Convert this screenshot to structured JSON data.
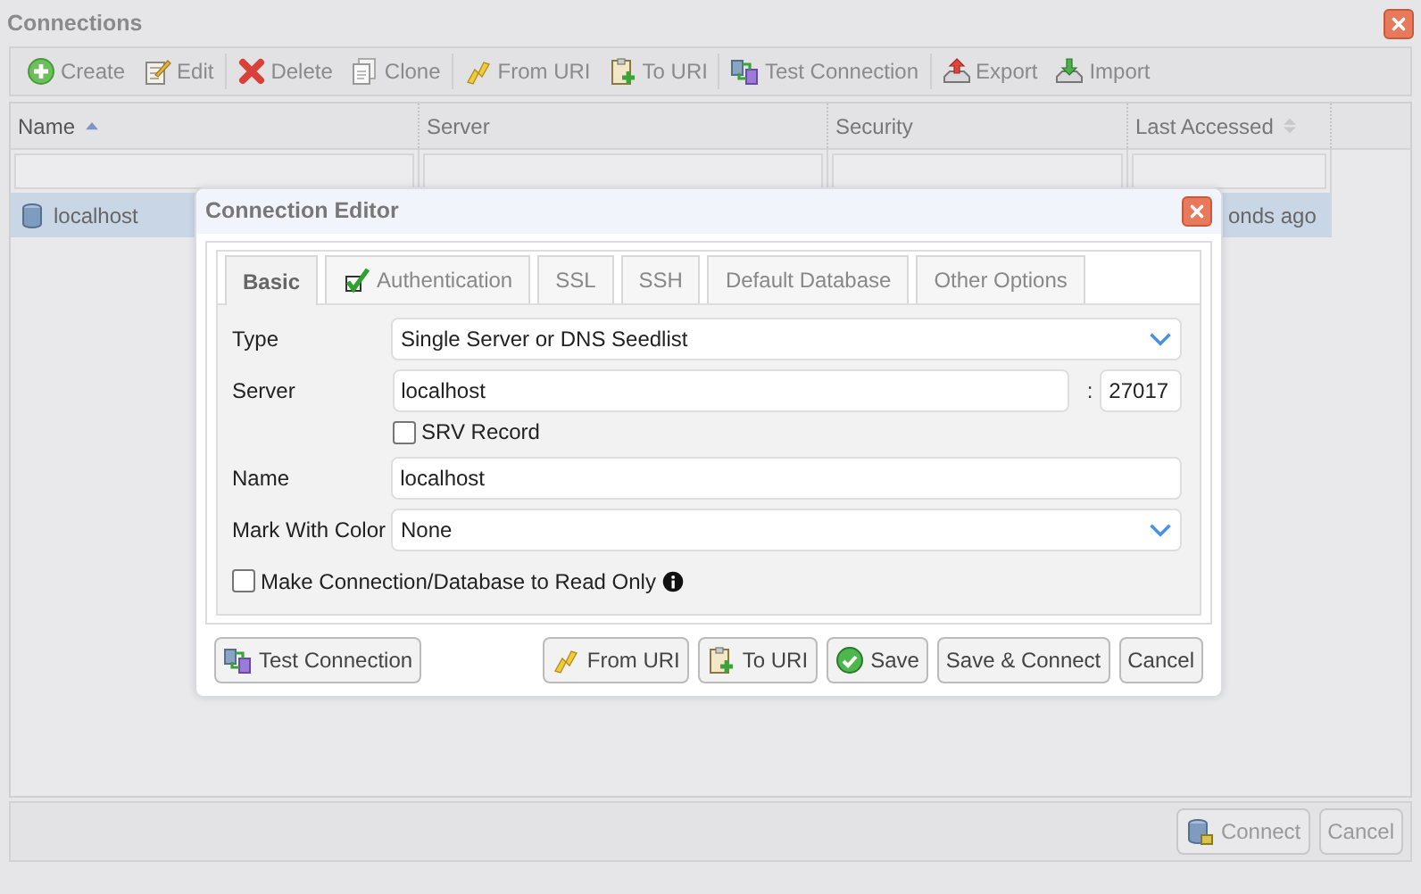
{
  "window": {
    "title": "Connections"
  },
  "toolbar": [
    {
      "label": "Create"
    },
    {
      "label": "Edit"
    },
    {
      "label": "Delete"
    },
    {
      "label": "Clone"
    },
    {
      "label": "From URI"
    },
    {
      "label": "To URI"
    },
    {
      "label": "Test Connection"
    },
    {
      "label": "Export"
    },
    {
      "label": "Import"
    }
  ],
  "grid": {
    "columns": [
      {
        "label": "Name",
        "kind": "sortable",
        "sorted": true
      },
      {
        "label": "Server",
        "kind": "plain",
        "sorted": false
      },
      {
        "label": "Security",
        "kind": "plain",
        "sorted": false
      },
      {
        "label": "Last Accessed",
        "kind": "sortable",
        "sorted": false
      }
    ],
    "rows": [
      {
        "name": "localhost",
        "last_accessed": "onds ago",
        "selected": true
      }
    ]
  },
  "footer_buttons": [
    {
      "label": "Connect",
      "icon": true
    },
    {
      "label": "Cancel",
      "icon": false
    }
  ],
  "dialog": {
    "title": "Connection Editor",
    "tabs": [
      {
        "label": "Basic",
        "selected": true,
        "verified": false
      },
      {
        "label": "Authentication",
        "selected": false,
        "verified": true
      },
      {
        "label": "SSL",
        "selected": false,
        "verified": false
      },
      {
        "label": "SSH",
        "selected": false,
        "verified": false
      },
      {
        "label": "Default Database",
        "selected": false,
        "verified": false
      },
      {
        "label": "Other Options",
        "selected": false,
        "verified": false
      }
    ],
    "type": {
      "label": "Type",
      "value": "Single Server or DNS Seedlist"
    },
    "server": {
      "label": "Server",
      "host": "localhost",
      "separator": ":",
      "port": "27017"
    },
    "srv_record": {
      "label": "SRV Record",
      "checked": false
    },
    "name": {
      "label": "Name",
      "value": "localhost"
    },
    "mark_color": {
      "label": "Mark With Color",
      "value": "None"
    },
    "read_only": {
      "label": "Make Connection/Database to Read Only",
      "checked": false
    },
    "buttons": [
      {
        "label": "Test Connection"
      },
      {
        "label": "From URI"
      },
      {
        "label": "To URI"
      },
      {
        "label": "Save"
      },
      {
        "label": "Save & Connect"
      },
      {
        "label": "Cancel"
      }
    ]
  }
}
